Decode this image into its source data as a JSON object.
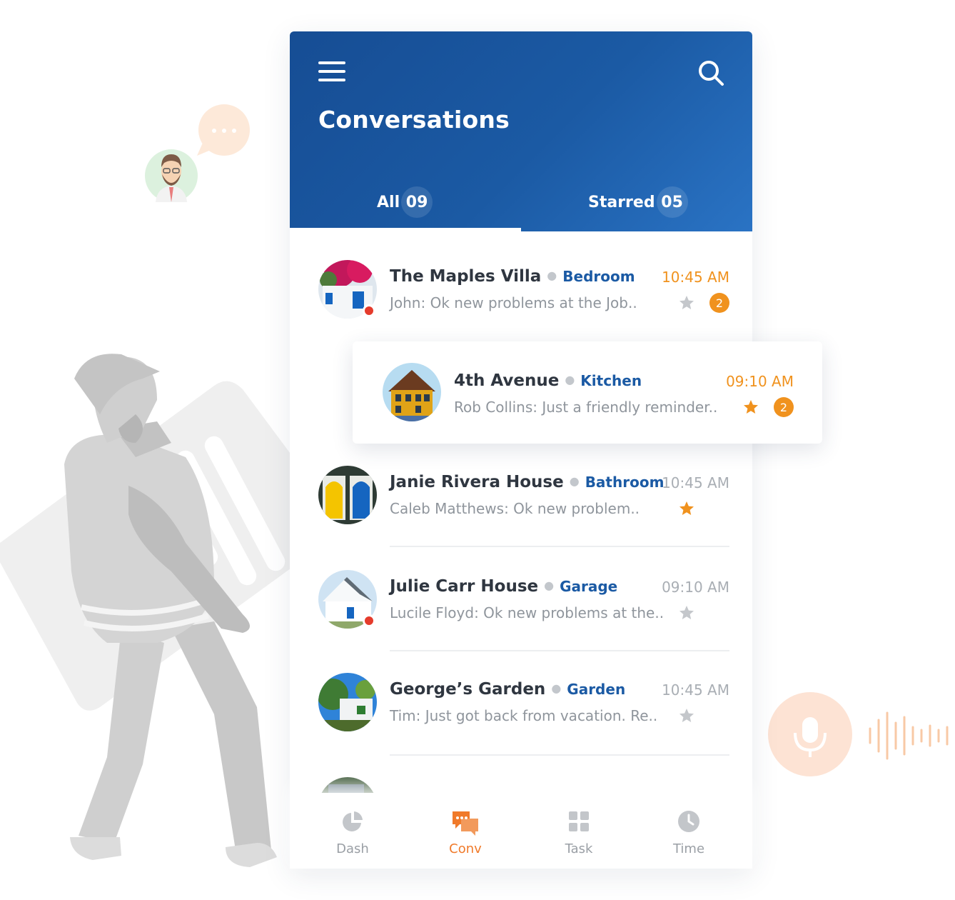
{
  "header": {
    "title": "Conversations",
    "tabs": [
      {
        "label": "All",
        "count": "09"
      },
      {
        "label": "Starred",
        "count": "05"
      }
    ]
  },
  "conversations": [
    {
      "name": "The Maples Villa",
      "room": "Bedroom",
      "time": "10:45 AM",
      "preview": "John: Ok new problems at the Job..",
      "starred": false,
      "unread": "2",
      "online": true
    },
    {
      "name": "4th Avenue",
      "room": "Kitchen",
      "time": "09:10 AM",
      "preview": "Rob Collins: Just a friendly reminder..",
      "starred": true,
      "unread": "2",
      "online": false
    },
    {
      "name": "Janie Rivera House",
      "room": "Bathroom",
      "time": "10:45 AM",
      "preview": "Caleb Matthews: Ok new problem..",
      "starred": true,
      "online": false
    },
    {
      "name": "Julie Carr House",
      "room": "Garage",
      "time": "09:10 AM",
      "preview": "Lucile Floyd: Ok new problems at the..",
      "starred": false,
      "online": true
    },
    {
      "name": "George’s Garden",
      "room": "Garden",
      "time": "10:45 AM",
      "preview": "Tim: Just got back from vacation. Re..",
      "starred": false,
      "online": false
    }
  ],
  "bottom_nav": [
    {
      "label": "Dash",
      "icon": "pie-chart-icon"
    },
    {
      "label": "Conv",
      "icon": "chat-bubbles-icon",
      "active": true
    },
    {
      "label": "Task",
      "icon": "grid-icon"
    },
    {
      "label": "Time",
      "icon": "clock-icon"
    }
  ],
  "colors": {
    "header_blue": "#1b5aa4",
    "accent_orange": "#f0921e",
    "online_red": "#e53b2c",
    "muted_gray": "#a9aeb4"
  },
  "illustration": {
    "figure": "worker-carrying-document-illustration",
    "chat_bubble": "typing-bubble-icon",
    "voice": "microphone-icon"
  }
}
